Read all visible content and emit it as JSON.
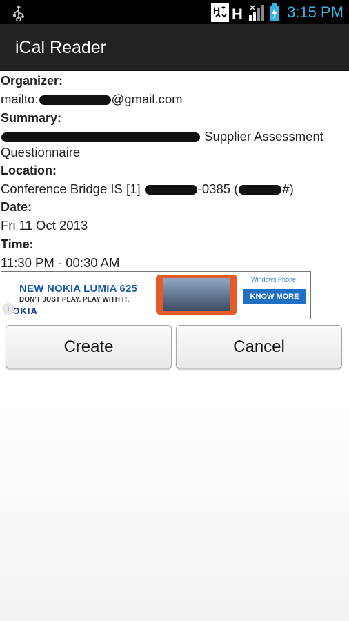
{
  "status_bar": {
    "time": "3:15 PM",
    "icons": [
      "usb-icon",
      "hplus-data-icon",
      "h-signal-icon",
      "signal-strength-icon",
      "battery-charging-icon"
    ],
    "accent_color": "#33b5e5"
  },
  "app": {
    "title": "iCal Reader"
  },
  "event": {
    "organizer_label": "Organizer:",
    "organizer_prefix": "mailto:",
    "organizer_suffix": "@gmail.com",
    "summary_label": "Summary:",
    "summary_visible": "Supplier Assessment",
    "summary_line2": "Questionnaire",
    "location_label": "Location:",
    "location_prefix": "Conference Bridge IS [1]",
    "location_mid": "-0385 (",
    "location_end": "#)",
    "date_label": "Date:",
    "date_value": "Fri 11 Oct 2013",
    "time_label": "Time:",
    "time_value": "11:30 PM - 00:30 AM"
  },
  "ad": {
    "headline": "NEW NOKIA LUMIA 625",
    "subline": "DON'T JUST PLAY. PLAY WITH IT.",
    "brand": "NOKIA",
    "platform": "Windows Phone",
    "cta": "KNOW MORE"
  },
  "buttons": {
    "create": "Create",
    "cancel": "Cancel"
  }
}
